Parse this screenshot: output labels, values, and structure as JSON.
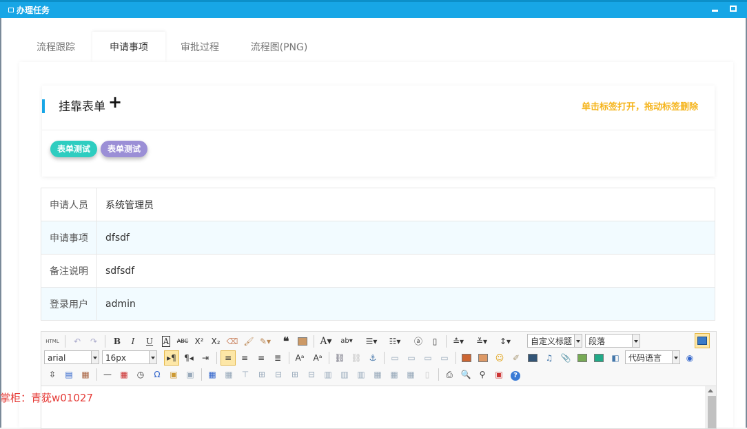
{
  "window": {
    "title": "办理任务"
  },
  "tabs": [
    "流程跟踪",
    "申请事项",
    "审批过程",
    "流程图(PNG)"
  ],
  "card": {
    "title": "挂靠表单",
    "hint": "单击标签打开，拖动标签删除",
    "tags": [
      "表单测试",
      "表单测试"
    ]
  },
  "info": [
    {
      "label": "申请人员",
      "value": "系统管理员"
    },
    {
      "label": "申请事项",
      "value": "dfsdf"
    },
    {
      "label": "备注说明",
      "value": "sdfsdf"
    },
    {
      "label": "登录用户",
      "value": "admin"
    }
  ],
  "editor": {
    "html_label": "HTML",
    "font_family": "arial",
    "font_size": "16px",
    "custom_heading": "自定义标题",
    "paragraph": "段落",
    "code_language": "代码语言"
  },
  "watermark": "掌柜：青莸w01027"
}
